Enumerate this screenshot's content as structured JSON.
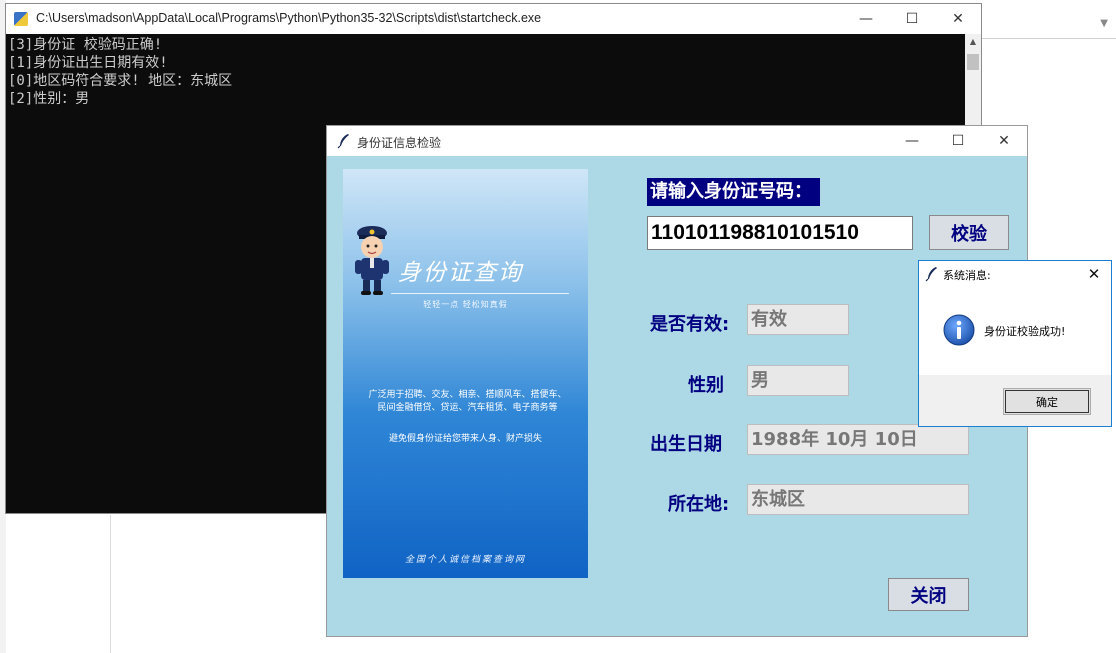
{
  "console": {
    "title": "C:\\Users\\madson\\AppData\\Local\\Programs\\Python\\Python35-32\\Scripts\\dist\\startcheck.exe",
    "lines": [
      "[3]身份证 校验码正确!",
      "[1]身份证出生日期有效!",
      "[0]地区码符合要求! 地区：东城区",
      "[2]性别：男"
    ]
  },
  "id_window": {
    "title": "身份证信息检验",
    "prompt": "请输入身份证号码：",
    "id_value": "110101198810101510",
    "check_button": "校验",
    "fields": {
      "valid_label": "是否有效:",
      "valid_value": "有效",
      "gender_label": "性别",
      "gender_value": "男",
      "birth_label": "出生日期",
      "birth_value": "1988年 10月 10日",
      "location_label": "所在地:",
      "location_value": "东城区"
    },
    "close_button": "关闭",
    "poster": {
      "title": "身份证查询",
      "subtitle": "轻轻一点  轻松知真假",
      "description": "广泛用于招聘、交友、相亲、搭顺风车、搭便车、民间金融借贷、贷运、汽车租赁、电子商务等",
      "warning": "避免假身份证给您带来人身、财产损失",
      "footer": "全国个人诚信档案查询网"
    }
  },
  "message_box": {
    "title": "系统消息:",
    "message": "身份证校验成功!",
    "ok_button": "确定"
  },
  "icons": {
    "console_app": "python-console-icon",
    "tk_app": "feather-icon",
    "info": "info-icon"
  },
  "colors": {
    "tk_background": "#add8e6",
    "label_navy": "#000080",
    "console_background": "#0c0c0c",
    "info_blue": "#1a5fb4"
  }
}
